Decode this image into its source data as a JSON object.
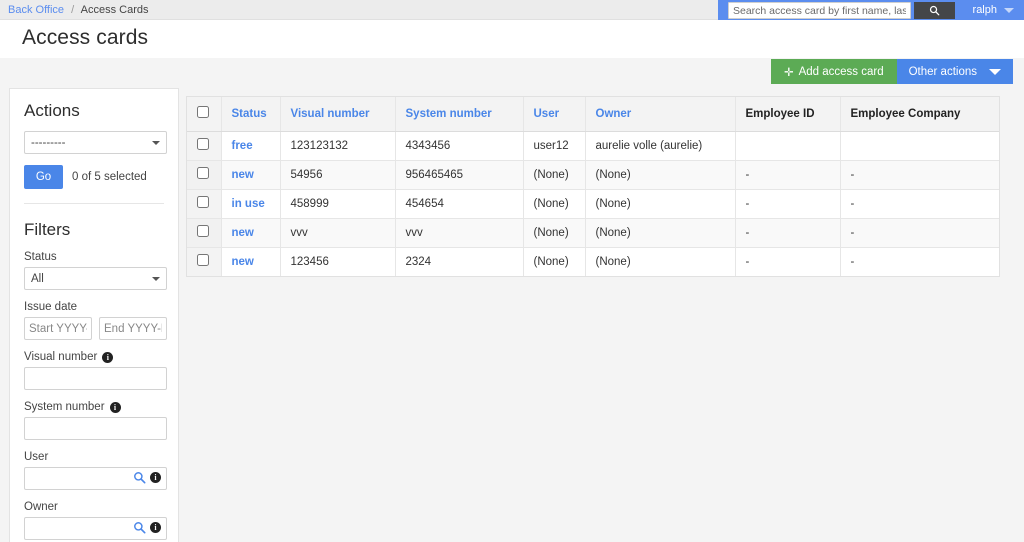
{
  "topbar": {
    "breadcrumb": {
      "root": "Back Office",
      "separator": "/",
      "current": "Access Cards"
    },
    "search": {
      "placeholder": "Search access card by first name, last name, email or card number",
      "value": "",
      "button_icon": "search-icon"
    },
    "user": {
      "name": "ralph",
      "caret_icon": "chevron-down-icon"
    },
    "accent_blue": "#5b8def",
    "search_button_color": "#444649"
  },
  "page": {
    "title": "Access cards"
  },
  "toolbar": {
    "add_label": "Add access card",
    "add_icon": "plus-icon",
    "add_color": "#5cab55",
    "other_label": "Other actions",
    "other_icon": "chevron-down-icon",
    "other_color": "#4a86e8"
  },
  "sidebar": {
    "actions": {
      "heading": "Actions",
      "select_value": "---------",
      "select_options": [
        "---------"
      ],
      "go_label": "Go",
      "selected_text": "0 of 5 selected"
    },
    "filters": {
      "heading": "Filters",
      "status": {
        "label": "Status",
        "value": "All",
        "options": [
          "All"
        ]
      },
      "issue_date": {
        "label": "Issue date",
        "start_placeholder": "Start YYYY-MM-DD",
        "start_value": "",
        "end_placeholder": "End YYYY-MM-DD",
        "end_value": ""
      },
      "visual_number": {
        "label": "Visual number",
        "info_icon": "info-icon",
        "value": ""
      },
      "system_number": {
        "label": "System number",
        "info_icon": "info-icon",
        "value": ""
      },
      "user": {
        "label": "User",
        "value": "",
        "search_icon": "search-icon",
        "info_icon": "info-icon"
      },
      "owner": {
        "label": "Owner",
        "value": "",
        "search_icon": "search-icon",
        "info_icon": "info-icon"
      }
    }
  },
  "table": {
    "select_all_label": "select-all",
    "columns": [
      {
        "key": "status",
        "label": "Status",
        "is_link": true
      },
      {
        "key": "visual",
        "label": "Visual number",
        "is_link": true
      },
      {
        "key": "system",
        "label": "System number",
        "is_link": true
      },
      {
        "key": "user",
        "label": "User",
        "is_link": true
      },
      {
        "key": "owner",
        "label": "Owner",
        "is_link": true
      },
      {
        "key": "employee_id",
        "label": "Employee ID",
        "is_link": false
      },
      {
        "key": "employee_company",
        "label": "Employee Company",
        "is_link": false
      }
    ],
    "rows": [
      {
        "status": "free",
        "visual": "123123132",
        "system": "4343456",
        "user": "user12",
        "owner": "aurelie volle (aurelie)",
        "employee_id": "",
        "employee_company": ""
      },
      {
        "status": "new",
        "visual": "54956",
        "system": "956465465",
        "user": "(None)",
        "owner": "(None)",
        "employee_id": "-",
        "employee_company": "-"
      },
      {
        "status": "in use",
        "visual": "458999",
        "system": "454654",
        "user": "(None)",
        "owner": "(None)",
        "employee_id": "-",
        "employee_company": "-"
      },
      {
        "status": "new",
        "visual": "vvv",
        "system": "vvv",
        "user": "(None)",
        "owner": "(None)",
        "employee_id": "-",
        "employee_company": "-"
      },
      {
        "status": "new",
        "visual": "123456",
        "system": "2324",
        "user": "(None)",
        "owner": "(None)",
        "employee_id": "-",
        "employee_company": "-"
      }
    ]
  }
}
